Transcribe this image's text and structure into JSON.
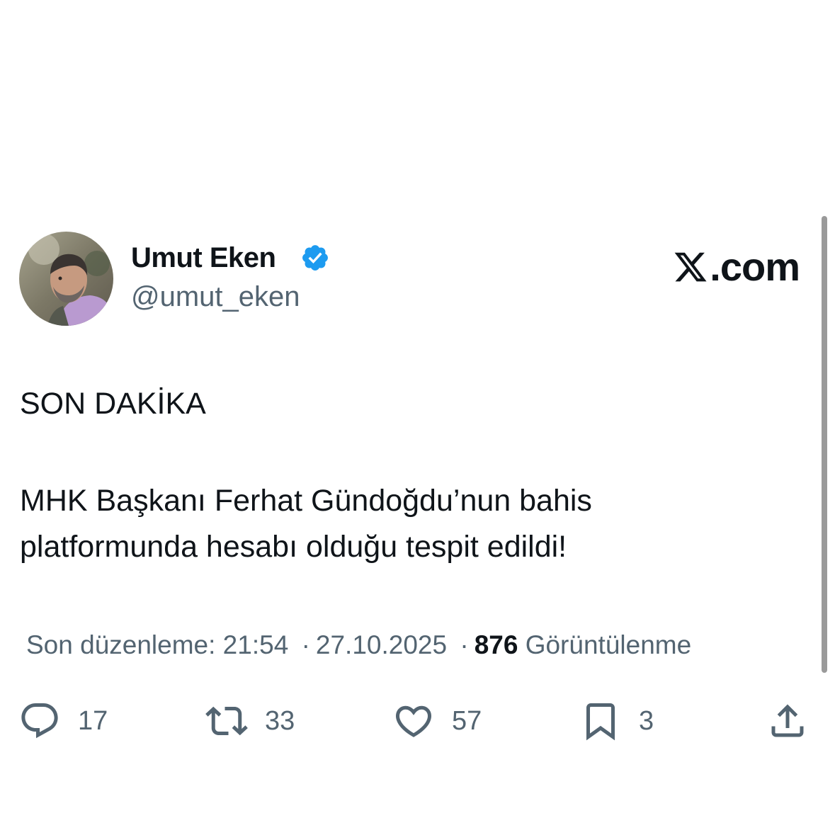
{
  "author": {
    "display_name": "Umut Eken",
    "handle": "@umut_eken",
    "verified": true,
    "avatar": "user-portrait"
  },
  "brand": {
    "label": ".com",
    "icon": "x-logo-icon"
  },
  "tweet": {
    "headline": "SON DAKİKA",
    "lines": [
      "MHK Başkanı Ferhat Gündoğdu’nun bahis",
      "platformunda hesabı olduğu tespit edildi!"
    ]
  },
  "meta": {
    "edited_label": "Son düzenleme: 21:54",
    "separator": "·",
    "date": "27.10.2025",
    "views_count": "876",
    "views_label": "Görüntülenme"
  },
  "actions": {
    "reply": {
      "icon": "reply-icon",
      "count": "17"
    },
    "repost": {
      "icon": "repost-icon",
      "count": "33"
    },
    "like": {
      "icon": "heart-icon",
      "count": "57"
    },
    "bookmark": {
      "icon": "bookmark-icon",
      "count": "3"
    },
    "share": {
      "icon": "share-icon"
    }
  },
  "colors": {
    "text": "#0f1419",
    "secondary": "#536471",
    "verified": "#1d9bf0"
  }
}
